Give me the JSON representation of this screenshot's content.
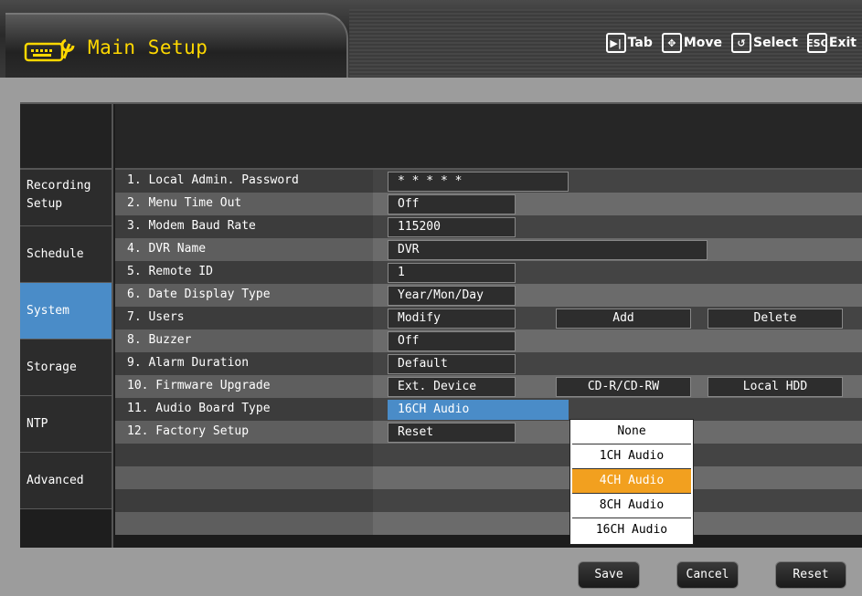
{
  "header": {
    "title": "Main Setup",
    "logo_icon": "wrench-keyboard-icon",
    "hints": [
      {
        "key_icon": "play-next-icon",
        "key_glyph": "▶|",
        "label": "Tab"
      },
      {
        "key_icon": "move-arrows-icon",
        "key_glyph": "✥",
        "label": "Move"
      },
      {
        "key_icon": "enter-icon",
        "key_glyph": "↺",
        "label": "Select"
      },
      {
        "key_icon": "esc-icon",
        "key_glyph": "ESC",
        "label": "Exit"
      }
    ]
  },
  "sidebar": {
    "items": [
      {
        "label": "Recording\nSetup",
        "active": false
      },
      {
        "label": "Schedule",
        "active": false
      },
      {
        "label": "System",
        "active": true
      },
      {
        "label": "Storage",
        "active": false
      },
      {
        "label": "NTP",
        "active": false
      },
      {
        "label": "Advanced",
        "active": false
      }
    ]
  },
  "settings": {
    "rows": [
      {
        "label": "1. Local Admin. Password",
        "value": "* * * * *"
      },
      {
        "label": "2. Menu Time Out",
        "value": "Off"
      },
      {
        "label": "3. Modem Baud Rate",
        "value": "115200"
      },
      {
        "label": "4. DVR Name",
        "value": "DVR"
      },
      {
        "label": "5. Remote ID",
        "value": "1"
      },
      {
        "label": "6. Date Display Type",
        "value": "Year/Mon/Day"
      },
      {
        "label": "7. Users",
        "value": "Modify",
        "extra": [
          "Add",
          "Delete"
        ]
      },
      {
        "label": "8. Buzzer",
        "value": "Off"
      },
      {
        "label": "9. Alarm Duration",
        "value": "Default"
      },
      {
        "label": "10. Firmware Upgrade",
        "value": "Ext. Device",
        "extra": [
          "CD-R/CD-RW",
          "Local HDD"
        ]
      },
      {
        "label": "11. Audio Board Type",
        "value": "16CH Audio"
      },
      {
        "label": "12. Factory Setup",
        "value": "Reset"
      }
    ]
  },
  "dropdown": {
    "options": [
      "None",
      "1CH Audio",
      "4CH Audio",
      "8CH Audio",
      "16CH Audio"
    ],
    "highlighted": "4CH Audio"
  },
  "footer": {
    "save": "Save",
    "cancel": "Cancel",
    "reset": "Reset"
  },
  "colors": {
    "title": "#ffd800",
    "selected": "#4a8cc8",
    "highlight": "#f2a01f"
  }
}
